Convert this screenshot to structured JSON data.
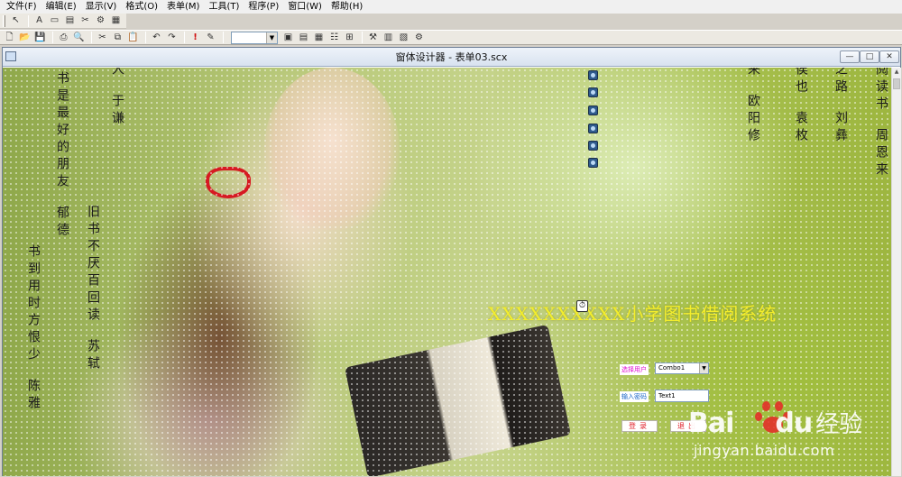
{
  "menu": [
    "文件(F)",
    "编辑(E)",
    "显示(V)",
    "格式(O)",
    "表单(M)",
    "工具(T)",
    "程序(P)",
    "窗口(W)",
    "帮助(H)"
  ],
  "toolbar_icons": {
    "new": "new-file-icon",
    "open": "open-folder-icon",
    "save": "save-icon",
    "print": "print-icon",
    "preview": "print-preview-icon",
    "cut": "cut-icon",
    "copy": "copy-icon",
    "paste": "paste-icon",
    "undo": "undo-icon",
    "redo": "redo-icon",
    "run": "run-icon",
    "modify": "modify-icon"
  },
  "window": {
    "title": "窗体设计器 - 表单03.scx",
    "minimize": "—",
    "maximize": "□",
    "close": "✕"
  },
  "poems": [
    {
      "text": "书是最好的朋友",
      "author": "郁德"
    },
    {
      "text": "书到用时方恨少",
      "author": "陈雅"
    },
    {
      "text": "旧书不厌百回读",
      "author": "苏轼"
    },
    {
      "text": "人",
      "author": "于谦"
    },
    {
      "text": "来",
      "author": "欧阳修"
    },
    {
      "text": "侯也",
      "author": "袁枚"
    },
    {
      "text": "之路",
      "author": "刘彝"
    },
    {
      "text": "阅读书",
      "author": "周恩来"
    }
  ],
  "form": {
    "title": "XXXXXXXXXX小学图书借阅系统",
    "user_label": "选择用户",
    "combo_value": "Combo1",
    "password_label": "输入密码",
    "text_value": "Text1",
    "login_button": "登录",
    "exit_button": "退出"
  },
  "watermark": {
    "brand": "Bai",
    "brand_suffix": "du",
    "experience": "经验",
    "url": "jingyan.baidu.com"
  },
  "colors": {
    "title_yellow": "#f3ee2c",
    "user_label": "#e010d0",
    "password_label": "#1a67c8",
    "button_text": "#e0202a"
  }
}
